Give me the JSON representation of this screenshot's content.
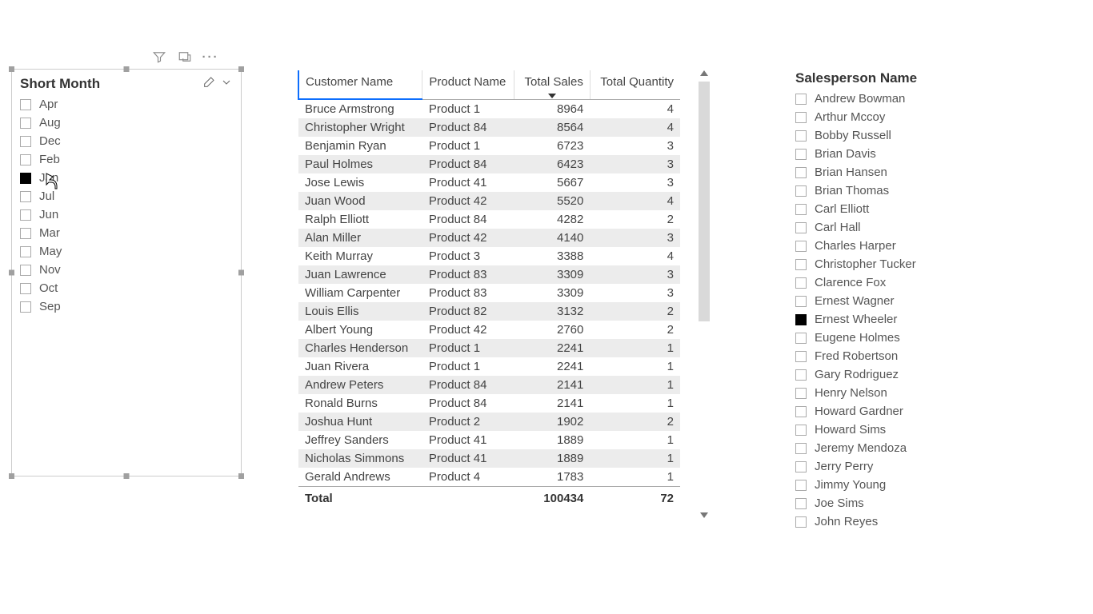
{
  "top_icons": {
    "filter": "filter-icon",
    "focus": "focus-mode-icon",
    "more": "more-options-icon"
  },
  "month_slicer": {
    "title": "Short Month",
    "items": [
      {
        "label": "Apr",
        "checked": false
      },
      {
        "label": "Aug",
        "checked": false
      },
      {
        "label": "Dec",
        "checked": false
      },
      {
        "label": "Feb",
        "checked": false
      },
      {
        "label": "Jan",
        "checked": true
      },
      {
        "label": "Jul",
        "checked": false
      },
      {
        "label": "Jun",
        "checked": false
      },
      {
        "label": "Mar",
        "checked": false
      },
      {
        "label": "May",
        "checked": false
      },
      {
        "label": "Nov",
        "checked": false
      },
      {
        "label": "Oct",
        "checked": false
      },
      {
        "label": "Sep",
        "checked": false
      }
    ]
  },
  "table": {
    "columns": [
      "Customer Name",
      "Product Name",
      "Total Sales",
      "Total Quantity"
    ],
    "sort_column_index": 2,
    "rows": [
      {
        "customer": "Bruce Armstrong",
        "product": "Product 1",
        "sales": "8964",
        "qty": "4"
      },
      {
        "customer": "Christopher Wright",
        "product": "Product 84",
        "sales": "8564",
        "qty": "4"
      },
      {
        "customer": "Benjamin Ryan",
        "product": "Product 1",
        "sales": "6723",
        "qty": "3"
      },
      {
        "customer": "Paul Holmes",
        "product": "Product 84",
        "sales": "6423",
        "qty": "3"
      },
      {
        "customer": "Jose Lewis",
        "product": "Product 41",
        "sales": "5667",
        "qty": "3"
      },
      {
        "customer": "Juan Wood",
        "product": "Product 42",
        "sales": "5520",
        "qty": "4"
      },
      {
        "customer": "Ralph Elliott",
        "product": "Product 84",
        "sales": "4282",
        "qty": "2"
      },
      {
        "customer": "Alan Miller",
        "product": "Product 42",
        "sales": "4140",
        "qty": "3"
      },
      {
        "customer": "Keith Murray",
        "product": "Product 3",
        "sales": "3388",
        "qty": "4"
      },
      {
        "customer": "Juan Lawrence",
        "product": "Product 83",
        "sales": "3309",
        "qty": "3"
      },
      {
        "customer": "William Carpenter",
        "product": "Product 83",
        "sales": "3309",
        "qty": "3"
      },
      {
        "customer": "Louis Ellis",
        "product": "Product 82",
        "sales": "3132",
        "qty": "2"
      },
      {
        "customer": "Albert Young",
        "product": "Product 42",
        "sales": "2760",
        "qty": "2"
      },
      {
        "customer": "Charles Henderson",
        "product": "Product 1",
        "sales": "2241",
        "qty": "1"
      },
      {
        "customer": "Juan Rivera",
        "product": "Product 1",
        "sales": "2241",
        "qty": "1"
      },
      {
        "customer": "Andrew Peters",
        "product": "Product 84",
        "sales": "2141",
        "qty": "1"
      },
      {
        "customer": "Ronald Burns",
        "product": "Product 84",
        "sales": "2141",
        "qty": "1"
      },
      {
        "customer": "Joshua Hunt",
        "product": "Product 2",
        "sales": "1902",
        "qty": "2"
      },
      {
        "customer": "Jeffrey Sanders",
        "product": "Product 41",
        "sales": "1889",
        "qty": "1"
      },
      {
        "customer": "Nicholas Simmons",
        "product": "Product 41",
        "sales": "1889",
        "qty": "1"
      },
      {
        "customer": "Gerald Andrews",
        "product": "Product 4",
        "sales": "1783",
        "qty": "1"
      }
    ],
    "total_label": "Total",
    "total_sales": "100434",
    "total_qty": "72"
  },
  "salesperson_slicer": {
    "title": "Salesperson Name",
    "items": [
      {
        "label": "Andrew Bowman",
        "checked": false
      },
      {
        "label": "Arthur Mccoy",
        "checked": false
      },
      {
        "label": "Bobby Russell",
        "checked": false
      },
      {
        "label": "Brian Davis",
        "checked": false
      },
      {
        "label": "Brian Hansen",
        "checked": false
      },
      {
        "label": "Brian Thomas",
        "checked": false
      },
      {
        "label": "Carl Elliott",
        "checked": false
      },
      {
        "label": "Carl Hall",
        "checked": false
      },
      {
        "label": "Charles Harper",
        "checked": false
      },
      {
        "label": "Christopher Tucker",
        "checked": false
      },
      {
        "label": "Clarence Fox",
        "checked": false
      },
      {
        "label": "Ernest Wagner",
        "checked": false
      },
      {
        "label": "Ernest Wheeler",
        "checked": true
      },
      {
        "label": "Eugene Holmes",
        "checked": false
      },
      {
        "label": "Fred Robertson",
        "checked": false
      },
      {
        "label": "Gary Rodriguez",
        "checked": false
      },
      {
        "label": "Henry Nelson",
        "checked": false
      },
      {
        "label": "Howard Gardner",
        "checked": false
      },
      {
        "label": "Howard Sims",
        "checked": false
      },
      {
        "label": "Jeremy Mendoza",
        "checked": false
      },
      {
        "label": "Jerry Perry",
        "checked": false
      },
      {
        "label": "Jimmy Young",
        "checked": false
      },
      {
        "label": "Joe Sims",
        "checked": false
      },
      {
        "label": "John Reyes",
        "checked": false
      }
    ]
  }
}
